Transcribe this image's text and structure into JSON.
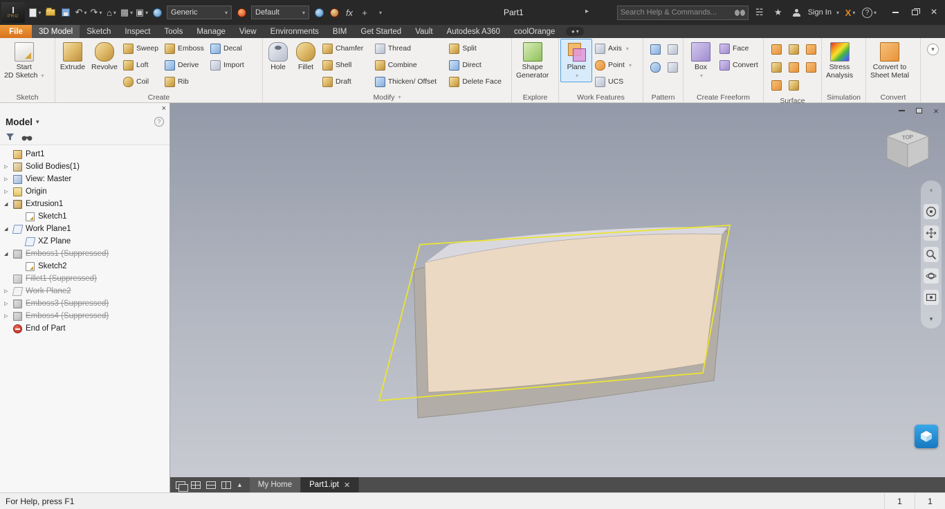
{
  "titlebar": {
    "logo_i": "I",
    "logo_text": "PRO",
    "material_value": "Generic",
    "appearance_value": "Default",
    "doc_title": "Part1",
    "search_placeholder": "Search Help & Commands...",
    "sign_in_label": "Sign In",
    "fx_icon_text": "fx"
  },
  "menubar": {
    "file_label": "File",
    "tabs": [
      "3D Model",
      "Sketch",
      "Inspect",
      "Tools",
      "Manage",
      "View",
      "Environments",
      "BIM",
      "Get Started",
      "Vault",
      "Autodesk A360",
      "coolOrange"
    ],
    "active_tab": "3D Model"
  },
  "ribbon": {
    "sketch": {
      "group_label": "Sketch",
      "start_sketch_line1": "Start",
      "start_sketch_line2": "2D Sketch"
    },
    "create": {
      "group_label": "Create",
      "extrude": "Extrude",
      "revolve": "Revolve",
      "sweep": "Sweep",
      "loft": "Loft",
      "coil": "Coil",
      "emboss": "Emboss",
      "derive": "Derive",
      "rib": "Rib",
      "decal": "Decal",
      "import": "Import"
    },
    "modify": {
      "group_label": "Modify",
      "hole": "Hole",
      "fillet": "Fillet",
      "chamfer": "Chamfer",
      "shell": "Shell",
      "draft": "Draft",
      "thread": "Thread",
      "combine": "Combine",
      "thicken_offset": "Thicken/ Offset",
      "split": "Split",
      "direct": "Direct",
      "delete_face": "Delete Face"
    },
    "explore": {
      "group_label": "Explore",
      "shape_generator_line1": "Shape",
      "shape_generator_line2": "Generator"
    },
    "work_features": {
      "group_label": "Work Features",
      "plane": "Plane",
      "axis": "Axis",
      "point": "Point",
      "ucs": "UCS"
    },
    "pattern": {
      "group_label": "Pattern"
    },
    "freeform": {
      "group_label": "Create Freeform",
      "box": "Box",
      "face": "Face",
      "convert": "Convert"
    },
    "surface": {
      "group_label": "Surface"
    },
    "simulation": {
      "group_label": "Simulation",
      "stress_line1": "Stress",
      "stress_line2": "Analysis"
    },
    "convert": {
      "group_label": "Convert",
      "sheet_line1": "Convert to",
      "sheet_line2": "Sheet Metal"
    }
  },
  "browser": {
    "panel_title": "Model",
    "items": [
      {
        "label": "Part1"
      },
      {
        "label": "Solid Bodies(1)"
      },
      {
        "label": "View: Master"
      },
      {
        "label": "Origin"
      },
      {
        "label": "Extrusion1"
      },
      {
        "label": "Sketch1"
      },
      {
        "label": "Work Plane1"
      },
      {
        "label": "XZ Plane"
      },
      {
        "label": "Emboss1 (Suppressed)"
      },
      {
        "label": "Sketch2"
      },
      {
        "label": "Fillet1 (Suppressed)"
      },
      {
        "label": "Work Plane2"
      },
      {
        "label": "Emboss3 (Suppressed)"
      },
      {
        "label": "Emboss4 (Suppressed)"
      },
      {
        "label": "End of Part"
      }
    ]
  },
  "viewport": {
    "viewcube_top_label": "TOP",
    "doc_tabs": {
      "my_home": "My Home",
      "part_tab": "Part1.ipt"
    }
  },
  "statusbar": {
    "help_text": "For Help, press F1",
    "field1": "1",
    "field2": "1"
  },
  "colors": {
    "file_button_orange": "#d9731e",
    "selected_tool_blue": "#d8ebfa",
    "workplane_yellow": "#ece431",
    "model_tan": "#ecd9c3",
    "a360_blue": "#2090e0",
    "viewport_gradient_top": "#9399a8",
    "viewport_gradient_bottom": "#caccd3"
  }
}
